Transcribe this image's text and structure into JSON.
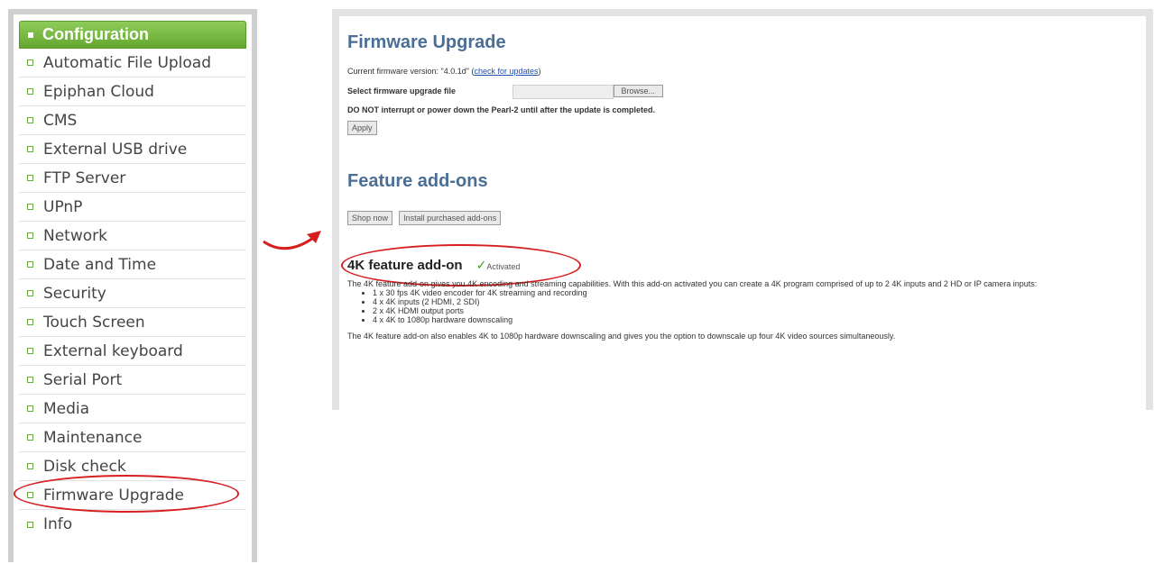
{
  "sidebar": {
    "header": "Configuration",
    "items": [
      {
        "label": "Automatic File Upload"
      },
      {
        "label": "Epiphan Cloud"
      },
      {
        "label": "CMS"
      },
      {
        "label": "External USB drive"
      },
      {
        "label": "FTP Server"
      },
      {
        "label": "UPnP"
      },
      {
        "label": "Network"
      },
      {
        "label": "Date and Time"
      },
      {
        "label": "Security"
      },
      {
        "label": "Touch Screen"
      },
      {
        "label": "External keyboard"
      },
      {
        "label": "Serial Port"
      },
      {
        "label": "Media"
      },
      {
        "label": "Maintenance"
      },
      {
        "label": "Disk check"
      },
      {
        "label": "Firmware Upgrade",
        "highlighted": true
      },
      {
        "label": "Info"
      }
    ]
  },
  "firmware": {
    "title": "Firmware Upgrade",
    "current_prefix": "Current firmware version: \"4.0.1d\" (",
    "check_link": "check for updates",
    "current_suffix": ")",
    "select_label": "Select firmware upgrade file",
    "browse_label": "Browse...",
    "warning": "DO NOT interrupt or power down the Pearl-2 until after the update is completed.",
    "apply_label": "Apply"
  },
  "addons": {
    "title": "Feature add-ons",
    "shop_label": "Shop now",
    "install_label": "Install purchased add-ons",
    "feature": {
      "title": "4K feature add-on",
      "status": "Activated",
      "intro": "The 4K feature add-on gives you 4K encoding and streaming capabilities. With this add-on activated you can create a 4K program comprised of up to 2 4K inputs and 2 HD or IP camera inputs:",
      "bullets": [
        "1 x 30 fps 4K video encoder for 4K streaming and recording",
        "4 x 4K inputs (2 HDMI, 2 SDI)",
        "2 x 4K HDMI output ports",
        "4 x 4K to 1080p hardware downscaling"
      ],
      "footer": "The 4K feature add-on also enables 4K to 1080p hardware downscaling and gives you the option to downscale up four 4K video sources simultaneously."
    }
  },
  "colors": {
    "accent_green": "#63a72f",
    "title_blue": "#4a6e95",
    "highlight_red": "#d62020"
  }
}
